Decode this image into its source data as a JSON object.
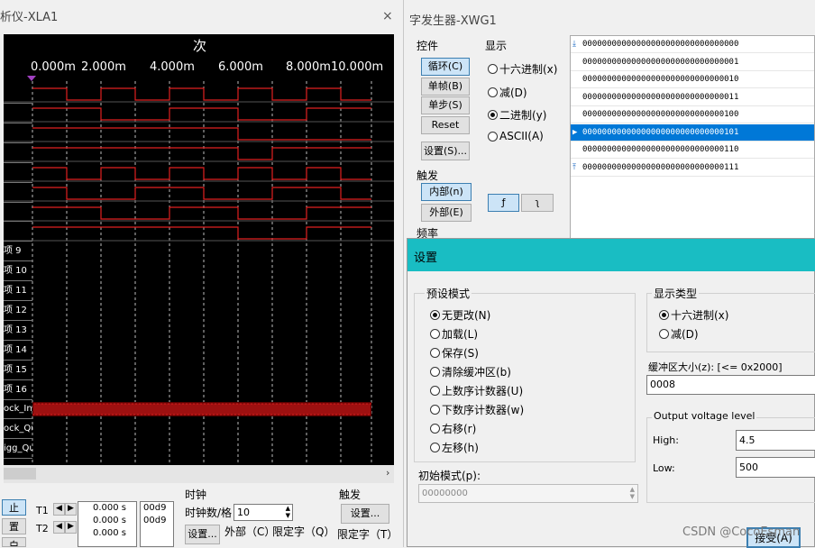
{
  "la": {
    "title": "析仪-XLA1",
    "close": "×",
    "time_unit": "次",
    "ticks": [
      "0.000m",
      "2.000m",
      "4.000m",
      "6.000m",
      "8.000m",
      "10.000m"
    ],
    "channel_labels": [
      "",
      "",
      "",
      "",
      "",
      "",
      "",
      "",
      "项 9",
      "项 10",
      "项 11",
      "项 12",
      "项 13",
      "项 14",
      "项 15",
      "项 16",
      "ock_Int",
      "ock_Qua",
      "igg_Qua"
    ],
    "left_buttons": [
      "止",
      "置",
      "白"
    ],
    "t1_label": "T1",
    "t2_label": "T2",
    "t_values": [
      "0.000 s",
      "0.000 s",
      "0.000 s"
    ],
    "t_hex": [
      "00d9",
      "00d9"
    ],
    "clock_title": "时钟",
    "clock_per_div_label": "时钟数/格",
    "clock_per_div": "10",
    "clock_settings": "设置...",
    "external_label": "外部（C）",
    "qualifier_label": "限定字（Q）",
    "trigger_title": "触发",
    "trigger_settings": "设置...",
    "trigger_qualifier": "限定字（T）"
  },
  "wg": {
    "title": "字发生器-XWG1",
    "controls_title": "控件",
    "btn_cycle": "循环(C)",
    "btn_burst": "单帧(B)",
    "btn_step": "单步(S)",
    "btn_reset": "Reset",
    "btn_settings": "设置(S)...",
    "display_title": "显示",
    "display_hex": "十六进制(x)",
    "display_dec": "减(D)",
    "display_bin": "二进制(y)",
    "display_ascii": "ASCII(A)",
    "trigger_title": "触发",
    "trig_internal": "内部(n)",
    "trig_external": "外部(E)",
    "edge_rise": "ƒ",
    "edge_fall": "ʅ",
    "freq_title": "频率",
    "words": [
      "00000000000000000000000000000000",
      "00000000000000000000000000000001",
      "00000000000000000000000000000010",
      "00000000000000000000000000000011",
      "00000000000000000000000000000100",
      "00000000000000000000000000000101",
      "00000000000000000000000000000110",
      "00000000000000000000000000000111"
    ],
    "selected_index": 5
  },
  "dlg": {
    "title": "设置",
    "preset_title": "预设模式",
    "preset_options": [
      "无更改(N)",
      "加载(L)",
      "保存(S)",
      "清除缓冲区(b)",
      "上数序计数器(U)",
      "下数序计数器(w)",
      "右移(r)",
      "左移(h)"
    ],
    "preset_selected": 0,
    "init_pattern_label": "初始模式(p):",
    "init_pattern_value": "00000000",
    "display_type_title": "显示类型",
    "display_type_options": [
      "十六进制(x)",
      "减(D)"
    ],
    "display_type_selected": 0,
    "buffer_label": "缓冲区大小(z): [<= 0x2000]",
    "buffer_value": "0008",
    "voltage_title": "Output voltage level",
    "high_label": "High:",
    "high_value": "4.5",
    "low_label": "Low:",
    "low_value": "500",
    "accept_button": "接受(A)"
  },
  "watermark": "CSDN @CocoEsman"
}
